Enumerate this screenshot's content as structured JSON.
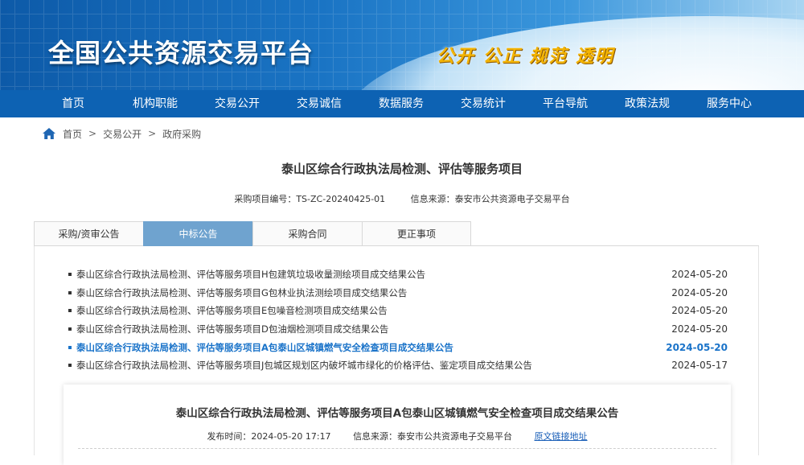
{
  "banner": {
    "title": "全国公共资源交易平台",
    "slogan": "公开 公正 规范 透明"
  },
  "nav": {
    "items": [
      "首页",
      "机构职能",
      "交易公开",
      "交易诚信",
      "数据服务",
      "交易统计",
      "平台导航",
      "政策法规",
      "服务中心"
    ]
  },
  "breadcrumb": {
    "home": "首页",
    "level1": "交易公开",
    "level2": "政府采购"
  },
  "project": {
    "title": "泰山区综合行政执法局检测、评估等服务项目",
    "code": "采购项目编号：TS-ZC-20240425-01",
    "source": "信息来源：泰安市公共资源电子交易平台"
  },
  "tabs": [
    "采购/资审公告",
    "中标公告",
    "采购合同",
    "更正事项"
  ],
  "active_tab": "中标公告",
  "announcements": [
    {
      "title": "泰山区综合行政执法局检测、评估等服务项目H包建筑垃圾收量测绘项目成交结果公告",
      "date": "2024-05-20"
    },
    {
      "title": "泰山区综合行政执法局检测、评估等服务项目G包林业执法测绘项目成交结果公告",
      "date": "2024-05-20"
    },
    {
      "title": "泰山区综合行政执法局检测、评估等服务项目E包噪音检测项目成交结果公告",
      "date": "2024-05-20"
    },
    {
      "title": "泰山区综合行政执法局检测、评估等服务项目D包油烟检测项目成交结果公告",
      "date": "2024-05-20"
    },
    {
      "title": "泰山区综合行政执法局检测、评估等服务项目A包泰山区城镇燃气安全检查项目成交结果公告",
      "date": "2024-05-20"
    },
    {
      "title": "泰山区综合行政执法局检测、评估等服务项目J包城区规划区内破坏城市绿化的价格评估、鉴定项目成交结果公告",
      "date": "2024-05-17"
    }
  ],
  "detail": {
    "title": "泰山区综合行政执法局检测、评估等服务项目A包泰山区城镇燃气安全检查项目成交结果公告",
    "publish_time": "发布时间：2024-05-20 17:17",
    "source": "信息来源：泰安市公共资源电子交易平台",
    "link": "原文链接地址"
  },
  "colors": {
    "nav_bg": "#0d62b3",
    "tab_active": "#6fa3cf",
    "link_active": "#1a73c9",
    "slogan": "#f4b400"
  }
}
